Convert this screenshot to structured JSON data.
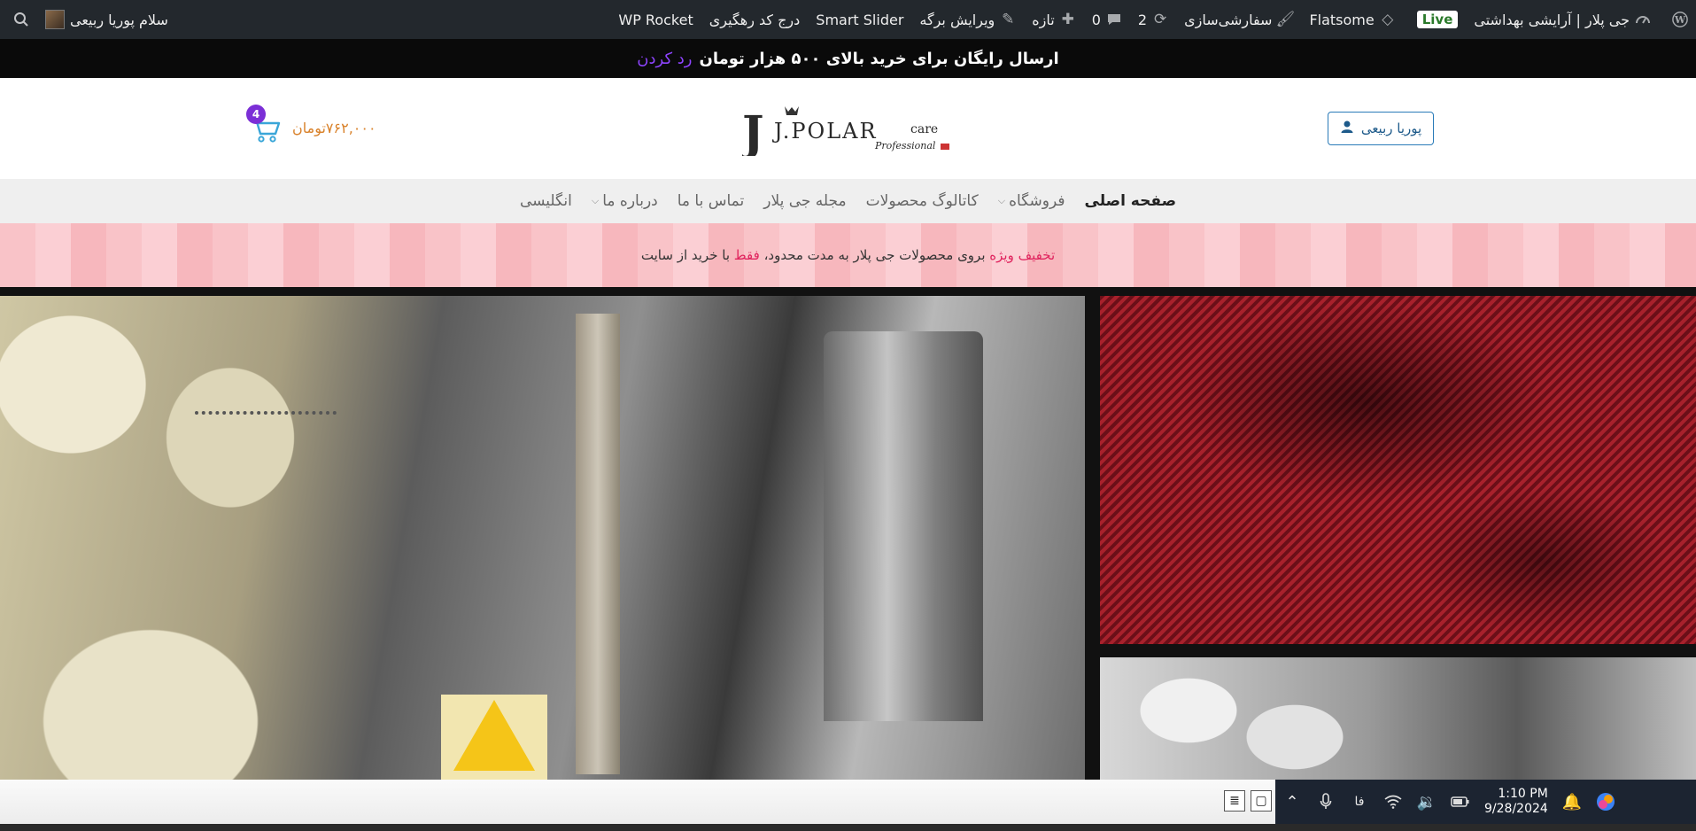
{
  "admin_bar": {
    "site_name": "جی پلار | آرایشی بهداشتی",
    "live_badge": "Live",
    "theme": "Flatsome",
    "customize": "سفارشی‌سازی",
    "updates_count": "2",
    "comments_count": "0",
    "new_label": "تازه",
    "edit_page": "ویرایش برگه",
    "smart_slider": "Smart Slider",
    "tracking_code": "درج کد رهگیری",
    "wp_rocket": "WP Rocket",
    "greeting": "سلام پوریا ربیعی"
  },
  "promo_bar": {
    "text": "ارسال رایگان برای خرید بالای ۵۰۰ هزار تومان",
    "dismiss_link": "رد کردن"
  },
  "header": {
    "account_label": "پوریا ربیعی",
    "logo_text": "J.POLAR",
    "logo_care": "care",
    "logo_sub": "Professional",
    "cart_total": "۷۶۲,۰۰۰تومان",
    "cart_count": "4"
  },
  "nav": {
    "items": [
      {
        "label": "صفحه اصلی",
        "active": true,
        "dropdown": false
      },
      {
        "label": "فروشگاه",
        "active": false,
        "dropdown": true
      },
      {
        "label": "کاتالوگ محصولات",
        "active": false,
        "dropdown": false
      },
      {
        "label": "مجله جی پلار",
        "active": false,
        "dropdown": false
      },
      {
        "label": "تماس با ما",
        "active": false,
        "dropdown": false
      },
      {
        "label": "درباره ما",
        "active": false,
        "dropdown": true
      },
      {
        "label": "انگلیسی",
        "active": false,
        "dropdown": false
      }
    ]
  },
  "discount_banner": {
    "highlight": "تخفیف ویژه",
    "middle": "بروی محصولات جی پلار به مدت محدود،",
    "only": "فقط",
    "end": "با خرید از سایت"
  },
  "taskbar": {
    "lang": "فا",
    "time": "1:10 PM",
    "date": "9/28/2024"
  },
  "colors": {
    "admin_bar_bg": "#23282d",
    "promo_link": "#8e44ff",
    "cart_price": "#d9822b",
    "cart_badge": "#7b2fd6",
    "discount_highlight": "#e0245e",
    "account_border": "#2a7bb8"
  },
  "icons": {
    "wordpress": "wordpress-icon",
    "dashboard": "dashboard-icon",
    "flatsome": "diamond-icon",
    "customize": "brush-icon",
    "updates": "refresh-icon",
    "comments": "comment-icon",
    "new": "plus-icon",
    "edit": "pencil-icon",
    "search": "search-icon",
    "user": "user-icon",
    "cart": "cart-icon"
  }
}
